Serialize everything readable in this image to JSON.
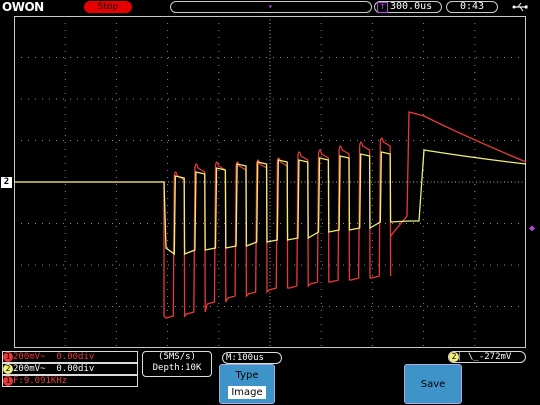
{
  "header": {
    "logo": "OWON",
    "run_state": "Stop",
    "trigger_position_marker": "▾",
    "timebase_badge": "T",
    "timebase": "300.0us",
    "clock": "0:43"
  },
  "markers": {
    "ch2_level": "2",
    "trigger_level_arrow": "◆",
    "trigger_time_marker": "T"
  },
  "bottom": {
    "ch1": {
      "badge": "1",
      "scale": "200mV~",
      "offset": "0.00div"
    },
    "ch2": {
      "badge": "2",
      "scale": "200mV~",
      "offset": "0.00div"
    },
    "frequency": {
      "badge": "1",
      "label": "F:9.091KHz"
    },
    "sample_rate": "(5MS/s)",
    "depth": "Depth:10K",
    "main_timebase": "M:100us",
    "trigger": {
      "badge": "2",
      "symbol": "⎸\\_",
      "level": "-272mV"
    },
    "type_button": {
      "label": "Type",
      "value": "Image"
    },
    "save_button": {
      "label": "Save"
    }
  },
  "colors": {
    "ch1": "#e83a3a",
    "ch2": "#f0ee7a",
    "grid": "#c8c8c8",
    "accent": "#3e93c8",
    "marker": "#b34ad6"
  },
  "icons": {
    "usb": "usb-icon",
    "trigger_edge": "falling-edge-icon"
  }
}
